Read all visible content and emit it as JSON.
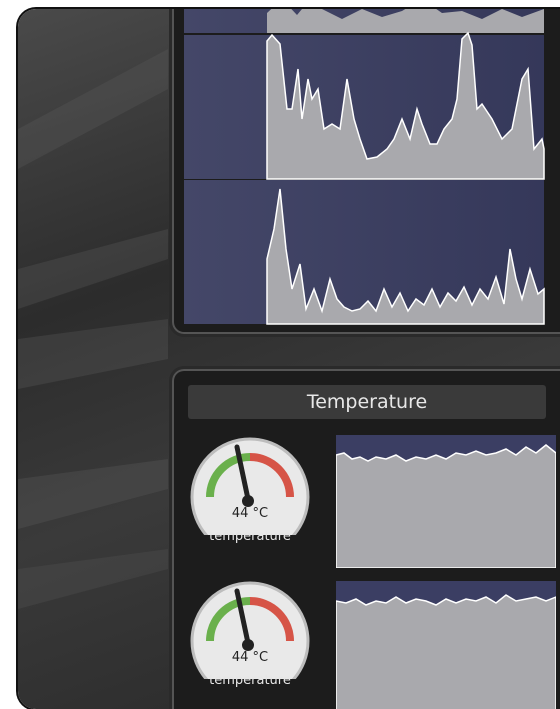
{
  "temperature_panel": {
    "title": "Temperature",
    "gauges": [
      {
        "value_text": "44 °C",
        "label": "temperature",
        "level": 0.44
      },
      {
        "value_text": "44 °C",
        "label": "temperature",
        "level": 0.44
      }
    ]
  },
  "colors": {
    "graph_bg": "#3b3e63",
    "graph_fill": "#a9a9ad",
    "graph_line": "#ffffff",
    "gauge_green": "#6ab04c",
    "gauge_red": "#d23a2a"
  }
}
